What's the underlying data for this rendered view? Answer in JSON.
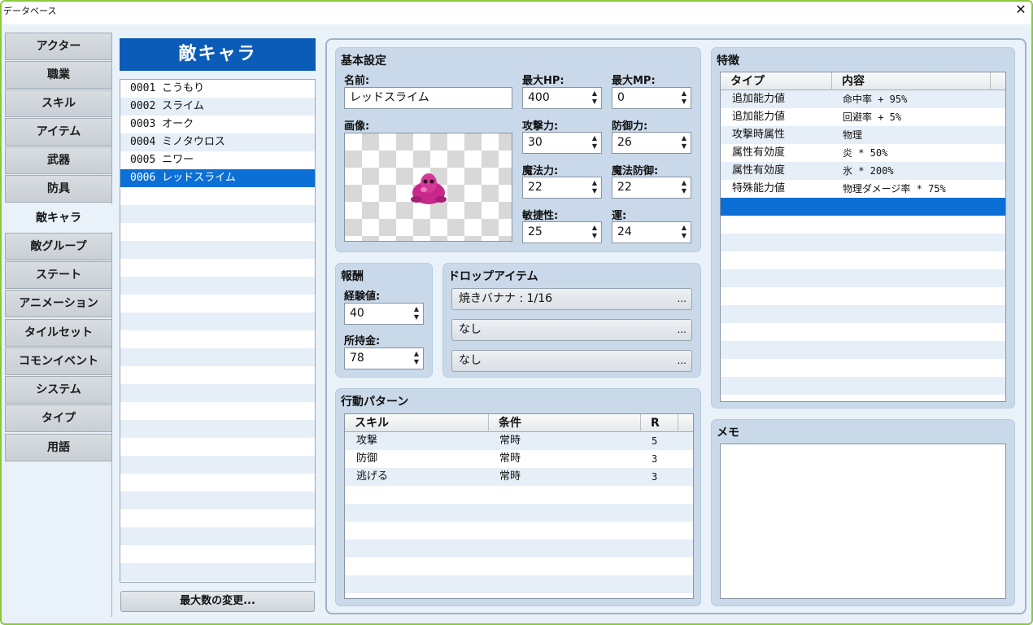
{
  "window": {
    "title": "データベース",
    "close": "✕"
  },
  "tabs": [
    "アクター",
    "職業",
    "スキル",
    "アイテム",
    "武器",
    "防具",
    "敵キャラ",
    "敵グループ",
    "ステート",
    "アニメーション",
    "タイルセット",
    "コモンイベント",
    "システム",
    "タイプ",
    "用語"
  ],
  "active_tab": "敵キャラ",
  "list": {
    "header": "敵キャラ",
    "items": [
      "0001 こうもり",
      "0002 スライム",
      "0003 オーク",
      "0004 ミノタウロス",
      "0005 ニワー",
      "0006 レッドスライム"
    ],
    "selected": "0006 レッドスライム",
    "max_button": "最大数の変更..."
  },
  "basic": {
    "title": "基本設定",
    "name_label": "名前:",
    "name_value": "レッドスライム",
    "image_label": "画像:",
    "maxhp_label": "最大HP:",
    "maxhp": "400",
    "maxmp_label": "最大MP:",
    "maxmp": "0",
    "atk_label": "攻撃力:",
    "atk": "30",
    "def_label": "防御力:",
    "def": "26",
    "mat_label": "魔法力:",
    "mat": "22",
    "mdf_label": "魔法防御:",
    "mdf": "22",
    "agi_label": "敏捷性:",
    "agi": "25",
    "luk_label": "運:",
    "luk": "24"
  },
  "reward": {
    "title": "報酬",
    "exp_label": "経験値:",
    "exp": "40",
    "gold_label": "所持金:",
    "gold": "78"
  },
  "drops": {
    "title": "ドロップアイテム",
    "items": [
      "焼きバナナ : 1/16",
      "なし",
      "なし"
    ],
    "dots": "..."
  },
  "actions": {
    "title": "行動パターン",
    "headers": [
      "スキル",
      "条件",
      "R"
    ],
    "rows": [
      [
        "攻撃",
        "常時",
        "5"
      ],
      [
        "防御",
        "常時",
        "3"
      ],
      [
        "逃げる",
        "常時",
        "3"
      ]
    ]
  },
  "traits": {
    "title": "特徴",
    "headers": [
      "タイプ",
      "内容"
    ],
    "rows": [
      [
        "追加能力値",
        "命中率 + 95%"
      ],
      [
        "追加能力値",
        "回避率 + 5%"
      ],
      [
        "攻撃時属性",
        "物理"
      ],
      [
        "属性有効度",
        "炎 * 50%"
      ],
      [
        "属性有効度",
        "氷 * 200%"
      ],
      [
        "特殊能力値",
        "物理ダメージ率 * 75%"
      ]
    ]
  },
  "memo": {
    "title": "メモ",
    "value": ""
  },
  "spin_up": "▲",
  "spin_down": "▼",
  "colors": {
    "accent": "#0b5cb8",
    "selection": "#0b6fd6",
    "group_bg": "#c9d9ea",
    "window_border": "#8ac83c"
  }
}
